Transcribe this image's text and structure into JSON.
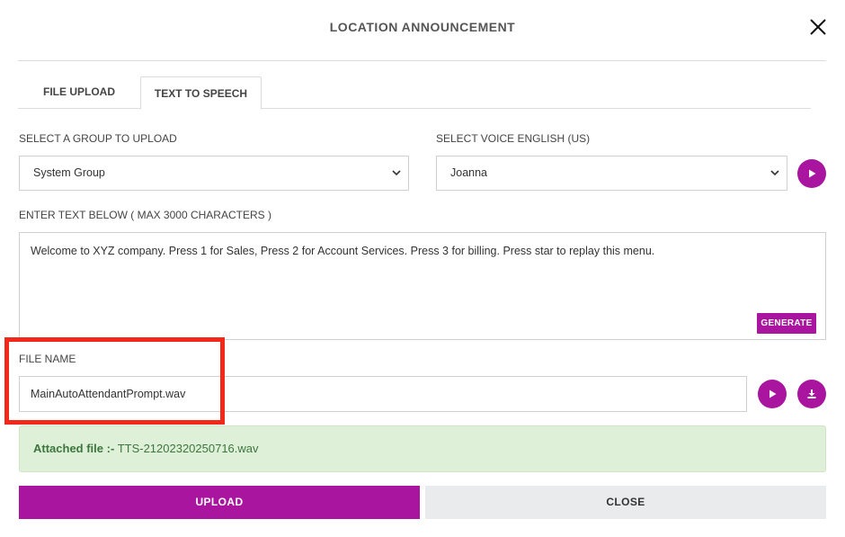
{
  "dialog": {
    "title": "LOCATION ANNOUNCEMENT",
    "close_icon": "close-icon"
  },
  "tabs": [
    {
      "label": "FILE UPLOAD",
      "active": false
    },
    {
      "label": "TEXT TO SPEECH",
      "active": true
    }
  ],
  "group_select": {
    "label": "SELECT A GROUP TO UPLOAD",
    "value": "System Group"
  },
  "voice_select": {
    "label": "SELECT VOICE ENGLISH (US)",
    "value": "Joanna",
    "play_icon": "play-icon"
  },
  "text_input": {
    "label": "ENTER TEXT BELOW ( MAX 3000 CHARACTERS )",
    "value": "Welcome to XYZ company. Press 1 for Sales, Press 2 for Account Services. Press 3 for billing. Press star to replay this menu.",
    "generate_label": "GENERATE"
  },
  "file_name": {
    "label": "FILE NAME",
    "value": "MainAutoAttendantPrompt.wav",
    "play_icon": "play-icon",
    "download_icon": "download-icon"
  },
  "attached": {
    "prefix": "Attached file :-",
    "file": "TTS-21202320250716.wav"
  },
  "actions": {
    "upload_label": "UPLOAD",
    "close_label": "CLOSE"
  },
  "colors": {
    "accent": "#a9159e",
    "success_bg": "#dff0d8",
    "success_text": "#3c763d",
    "highlight": "#f2281a"
  }
}
